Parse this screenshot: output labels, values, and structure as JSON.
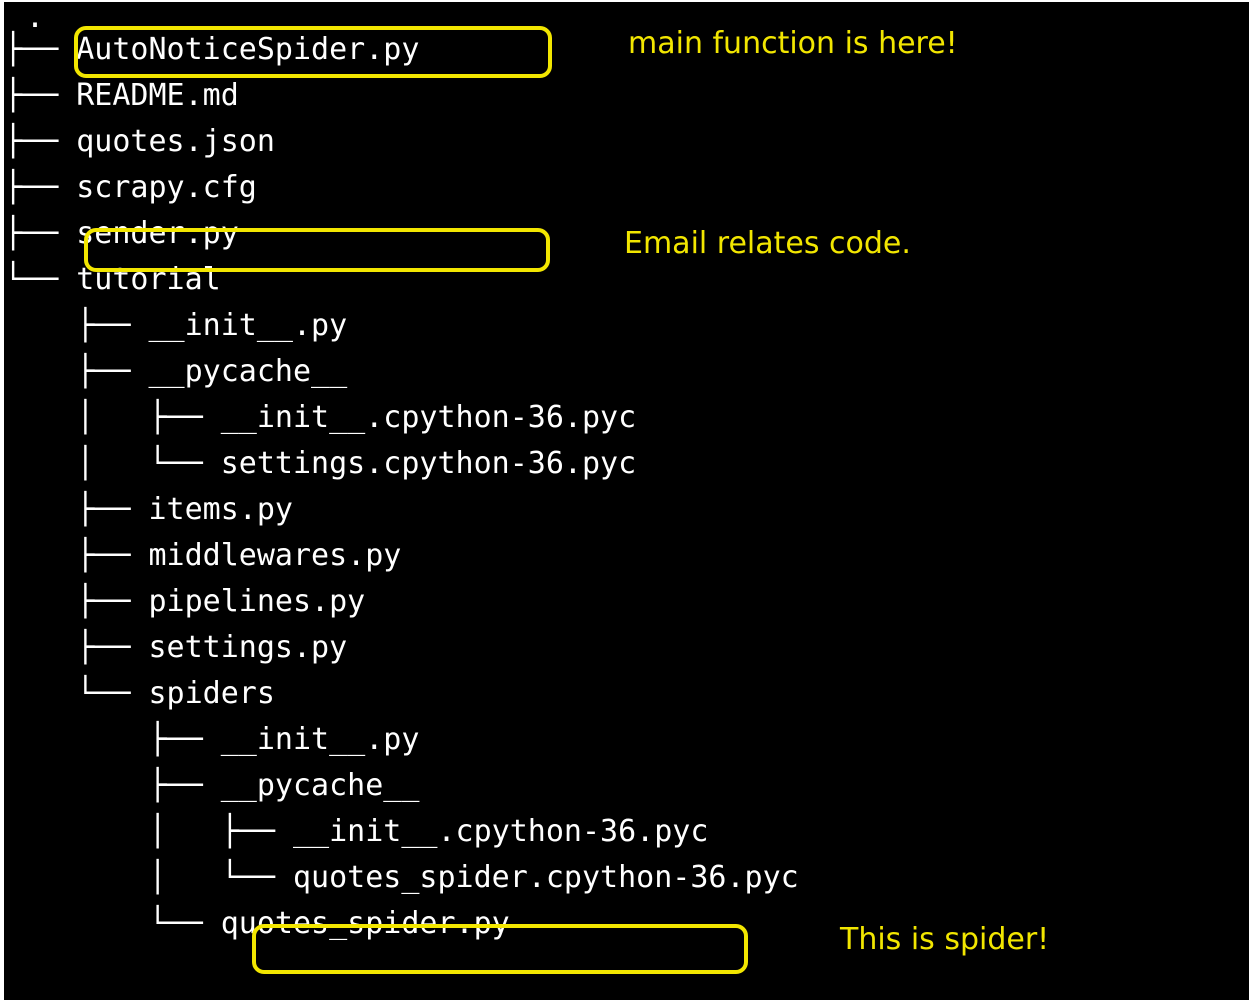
{
  "tree": {
    "root": ".",
    "entries": [
      {
        "prefix": "├──",
        "name": "AutoNoticeSpider.py"
      },
      {
        "prefix": "├──",
        "name": "README.md"
      },
      {
        "prefix": "├──",
        "name": "quotes.json"
      },
      {
        "prefix": "├──",
        "name": "scrapy.cfg"
      },
      {
        "prefix": "├──",
        "name": "sender.py"
      },
      {
        "prefix": "└──",
        "name": "tutorial"
      },
      {
        "prefix": "    ├──",
        "name": "__init__.py"
      },
      {
        "prefix": "    ├──",
        "name": "__pycache__"
      },
      {
        "prefix": "    │   ├──",
        "name": "__init__.cpython-36.pyc"
      },
      {
        "prefix": "    │   └──",
        "name": "settings.cpython-36.pyc"
      },
      {
        "prefix": "    ├──",
        "name": "items.py"
      },
      {
        "prefix": "    ├──",
        "name": "middlewares.py"
      },
      {
        "prefix": "    ├──",
        "name": "pipelines.py"
      },
      {
        "prefix": "    ├──",
        "name": "settings.py"
      },
      {
        "prefix": "    └──",
        "name": "spiders"
      },
      {
        "prefix": "        ├──",
        "name": "__init__.py"
      },
      {
        "prefix": "        ├──",
        "name": "__pycache__"
      },
      {
        "prefix": "        │   ├──",
        "name": "__init__.cpython-36.pyc"
      },
      {
        "prefix": "        │   └──",
        "name": "quotes_spider.cpython-36.pyc"
      },
      {
        "prefix": "        └──",
        "name": "quotes_spider.py"
      }
    ]
  },
  "annotations": {
    "main": "main function is here!",
    "email": "Email relates code.",
    "spider": "This is spider!"
  },
  "colors": {
    "background": "#000000",
    "text": "#ffffff",
    "highlight": "#f2e600"
  }
}
